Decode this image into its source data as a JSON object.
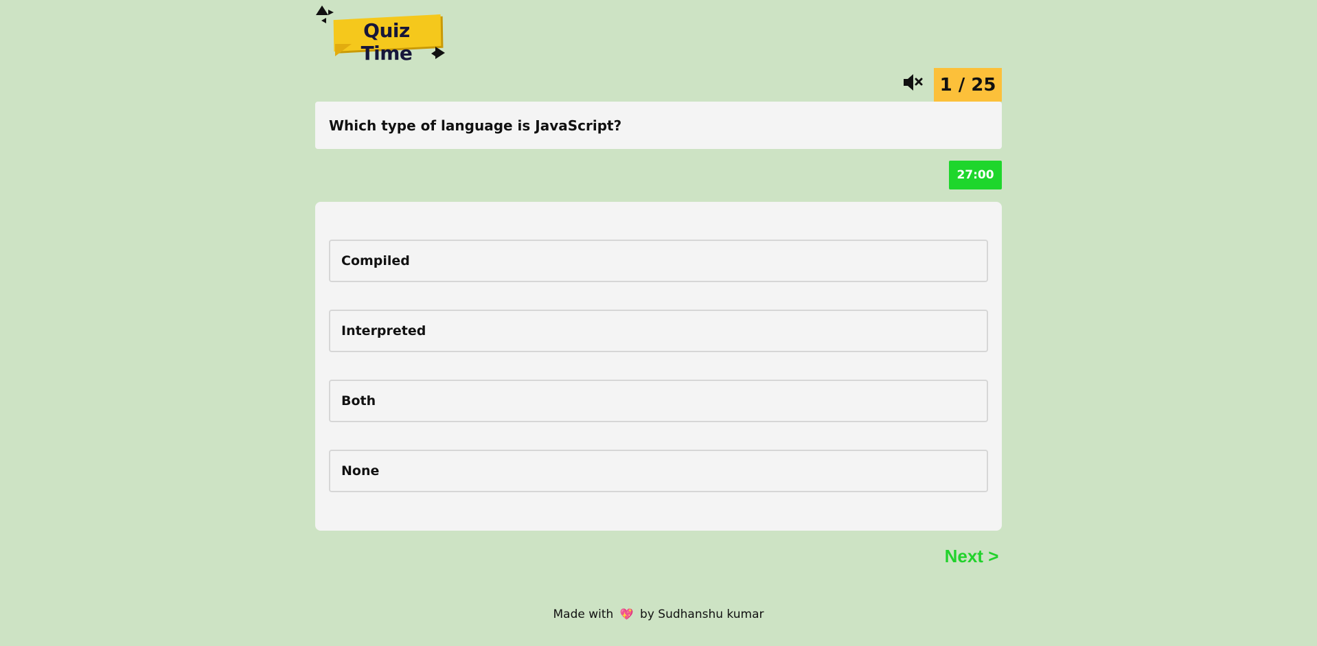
{
  "logo": {
    "text": "Quiz Time"
  },
  "counter": {
    "text": "1 / 25"
  },
  "question": {
    "text": "Which type of language is JavaScript?"
  },
  "timer": {
    "text": "27:00"
  },
  "options": [
    {
      "label": "Compiled"
    },
    {
      "label": "Interpreted"
    },
    {
      "label": "Both"
    },
    {
      "label": "None"
    }
  ],
  "navigation": {
    "next_label": "Next >"
  },
  "footer": {
    "prefix": "Made with",
    "heart": "💖",
    "suffix": "by Sudhanshu kumar"
  },
  "icons": {
    "mute": "speaker-muted-icon",
    "heart": "heart-icon"
  },
  "colors": {
    "background": "#cde3c4",
    "counter": "#fcc03a",
    "timer": "#1ed62c",
    "next": "#22d22c",
    "logo": "#f5c81c"
  }
}
